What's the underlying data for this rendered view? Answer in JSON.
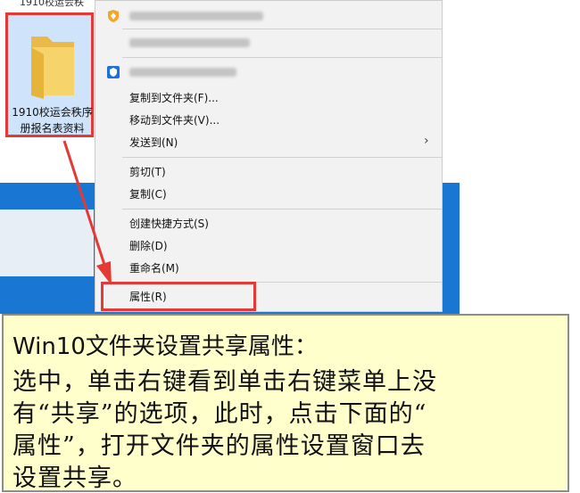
{
  "desktop": {
    "top_cut_text": "1910校运会秩",
    "folder_label_line1": "1910校运会秩序",
    "folder_label_line2": "册报名表资料"
  },
  "context_menu": {
    "items": [
      {
        "label": "复制到文件夹(F)..."
      },
      {
        "label": "移动到文件夹(V)..."
      },
      {
        "label": "发送到(N)"
      },
      {
        "label": "剪切(T)"
      },
      {
        "label": "复制(C)"
      },
      {
        "label": "创建快捷方式(S)"
      },
      {
        "label": "删除(D)"
      },
      {
        "label": "重命名(M)"
      },
      {
        "label": "属性(R)"
      }
    ]
  },
  "note": {
    "title": "Win10文件夹设置共享属性：",
    "line1": "选中，单击右键看到单击右键菜单上没",
    "line2": "有“共享”的选项，此时，点击下面的“",
    "line3": "属性”，打开文件夹的属性设置窗口去",
    "line4": "设置共享。"
  },
  "colors": {
    "highlight_red": "#e53935",
    "desktop_blue": "#1976d2",
    "note_bg": "#ffffcc",
    "menu_bg": "#f2f2f2"
  },
  "icons": [
    "folder-icon",
    "shield-orange-icon",
    "shield-blue-icon",
    "chevron-right-icon",
    "red-arrow"
  ]
}
